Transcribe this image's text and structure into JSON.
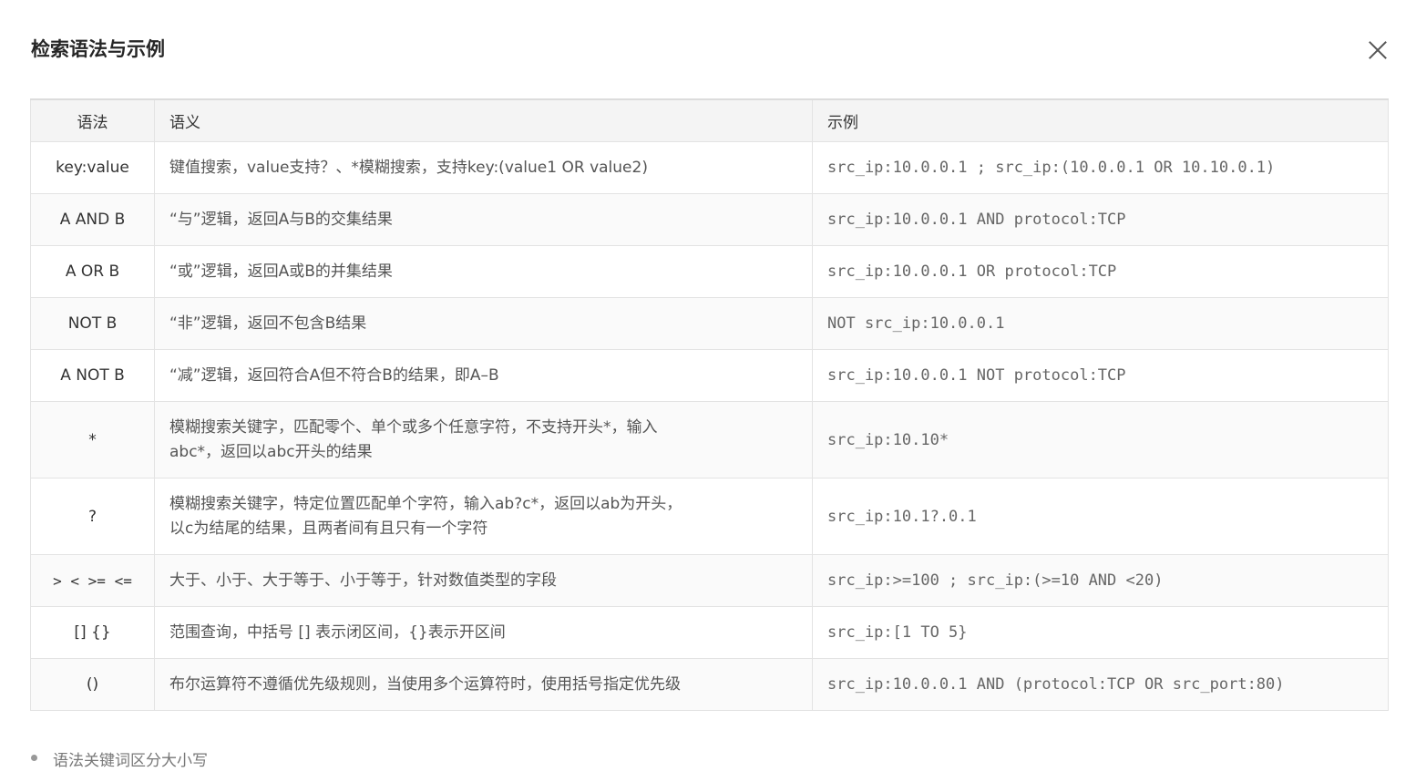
{
  "dialog": {
    "title": "检索语法与示例"
  },
  "table": {
    "headers": {
      "syntax": "语法",
      "meaning": "语义",
      "example": "示例"
    },
    "rows": [
      {
        "syntax": "key:value",
        "meaning": "键值搜索，value支持？、*模糊搜索，支持key:(value1 OR value2)",
        "example": "src_ip:10.0.0.1 ; src_ip:(10.0.0.1 OR 10.10.0.1)"
      },
      {
        "syntax": "A AND B",
        "meaning": "“与”逻辑，返回A与B的交集结果",
        "example": "src_ip:10.0.0.1 AND protocol:TCP"
      },
      {
        "syntax": "A OR B",
        "meaning": "“或”逻辑，返回A或B的并集结果",
        "example": "src_ip:10.0.0.1 OR protocol:TCP"
      },
      {
        "syntax": "NOT B",
        "meaning": "“非”逻辑，返回不包含B结果",
        "example": "NOT src_ip:10.0.0.1"
      },
      {
        "syntax": "A NOT B",
        "meaning": "“减”逻辑，返回符合A但不符合B的结果，即A–B",
        "example": "src_ip:10.0.0.1 NOT protocol:TCP"
      },
      {
        "syntax": "*",
        "meaning_lines": [
          "模糊搜索关键字，匹配零个、单个或多个任意字符，不支持开头*，输入",
          "abc*，返回以abc开头的结果"
        ],
        "example": "src_ip:10.10*"
      },
      {
        "syntax": "?",
        "meaning_lines": [
          "模糊搜索关键字，特定位置匹配单个字符，输入ab?c*，返回以ab为开头，",
          "以c为结尾的结果，且两者间有且只有一个字符"
        ],
        "example": "src_ip:10.1?.0.1"
      },
      {
        "syntax": "> < >= <=",
        "meaning": "大于、小于、大于等于、小于等于，针对数值类型的字段",
        "example": "src_ip:>=100 ; src_ip:(>=10 AND <20)"
      },
      {
        "syntax": "[] {}",
        "meaning": "范围查询，中括号 [] 表示闭区间，{}表示开区间",
        "example": "src_ip:[1 TO 5}"
      },
      {
        "syntax": "()",
        "meaning": "布尔运算符不遵循优先级规则，当使用多个运算符时，使用括号指定优先级",
        "example": "src_ip:10.0.0.1 AND (protocol:TCP OR src_port:80)"
      }
    ]
  },
  "notes": [
    "语法关键词区分大小写"
  ],
  "icons": {
    "close": "close-icon"
  }
}
